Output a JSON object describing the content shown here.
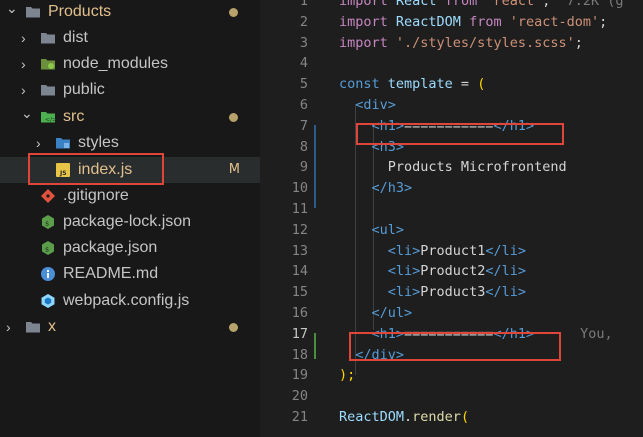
{
  "explorer": {
    "items": [
      {
        "label": "Products",
        "icon": "folder-icon",
        "expanded": true,
        "modified_dot": true
      },
      {
        "label": "dist",
        "icon": "folder-icon"
      },
      {
        "label": "node_modules",
        "icon": "node-folder-icon"
      },
      {
        "label": "public",
        "icon": "folder-icon"
      },
      {
        "label": "src",
        "icon": "src-folder-icon",
        "expanded": true,
        "modified_dot": true
      },
      {
        "label": "styles",
        "icon": "css-folder-icon"
      },
      {
        "label": "index.js",
        "icon": "js-file-icon",
        "badge": "M"
      },
      {
        "label": ".gitignore",
        "icon": "git-icon"
      },
      {
        "label": "package-lock.json",
        "icon": "npm-json-icon"
      },
      {
        "label": "package.json",
        "icon": "npm-json-icon"
      },
      {
        "label": "README.md",
        "icon": "info-icon"
      },
      {
        "label": "webpack.config.js",
        "icon": "webpack-icon"
      },
      {
        "label": "x",
        "icon": "folder-icon",
        "modified_dot": true
      }
    ]
  },
  "editor": {
    "line_numbers": [
      "1",
      "2",
      "3",
      "4",
      "5",
      "6",
      "7",
      "8",
      "9",
      "10",
      "11",
      "12",
      "13",
      "14",
      "15",
      "16",
      "17",
      "18",
      "19",
      "20",
      "21"
    ],
    "active_line": "17",
    "lines": [
      [
        "import",
        " React ",
        "from",
        " 'react'",
        ";",
        "  7.2K (g"
      ],
      [
        "import",
        " ReactDOM ",
        "from",
        " 'react-dom'",
        ";"
      ],
      [
        "import",
        " './styles/styles.scss'",
        ";"
      ],
      [],
      [
        "const",
        " template ",
        "=",
        " ("
      ],
      [
        "  ",
        "<div>"
      ],
      [
        "    ",
        "<h1>",
        "===========",
        "</h1>"
      ],
      [
        "    ",
        "<h3>"
      ],
      [
        "      ",
        "Products Microfrontend"
      ],
      [
        "    ",
        "</h3>"
      ],
      [],
      [
        "    ",
        "<ul>"
      ],
      [
        "      ",
        "<li>",
        "Product1",
        "</li>"
      ],
      [
        "      ",
        "<li>",
        "Product2",
        "</li>"
      ],
      [
        "      ",
        "<li>",
        "Product3",
        "</li>"
      ],
      [
        "    ",
        "</ul>"
      ],
      [
        "    ",
        "<h1>",
        "===========",
        "</h1>",
        "You,"
      ],
      [
        "  ",
        "</div>"
      ],
      [
        ");"
      ],
      [],
      [
        "ReactDOM",
        ".",
        "render",
        "("
      ]
    ]
  },
  "colors": {
    "keyword": "#c586c0",
    "string": "#ce9178",
    "tag": "#569cd6",
    "highlight_box": "#e0453a"
  }
}
